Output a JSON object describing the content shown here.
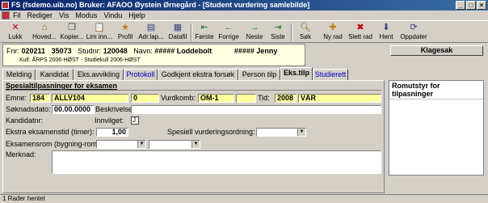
{
  "window": {
    "title": "FS (fsdemo.uib.no) Bruker: AFAOO Øystein Ørnegård - [Student vurdering samlebilde]"
  },
  "menu": [
    "Fil",
    "Rediger",
    "Vis",
    "Modus",
    "Vindu",
    "Hjelp"
  ],
  "toolbar": [
    {
      "label": "Lukk",
      "icon": "close-icon"
    },
    {
      "label": "Hoved...",
      "icon": "home-icon"
    },
    {
      "label": "Kopier...",
      "icon": "copy-icon"
    },
    {
      "label": "Lim inn...",
      "icon": "paste-icon"
    },
    {
      "label": "Profil",
      "icon": "profile-icon"
    },
    {
      "label": "Adr.lap...",
      "icon": "address-label-icon"
    },
    {
      "label": "Datafil",
      "icon": "datafile-icon"
    },
    {
      "label": "Første",
      "icon": "first-icon"
    },
    {
      "label": "Forrige",
      "icon": "previous-icon"
    },
    {
      "label": "Neste",
      "icon": "next-icon"
    },
    {
      "label": "Siste",
      "icon": "last-icon"
    },
    {
      "label": "Søk",
      "icon": "search-icon"
    },
    {
      "label": "Ny rad",
      "icon": "new-row-icon"
    },
    {
      "label": "Slett rad",
      "icon": "delete-row-icon"
    },
    {
      "label": "Hent",
      "icon": "fetch-icon"
    },
    {
      "label": "Oppdater",
      "icon": "update-icon"
    }
  ],
  "student": {
    "fnr_label": "Fnr:",
    "fnr": "020211",
    "fnr2": "35073",
    "studnr_label": "Studnr:",
    "studnr": "120048",
    "navn_label": "Navn:",
    "etternavn": "##### Loddebolt",
    "fornavn": "##### Jenny",
    "kull": "Kull: ÅRPS 2006-HØST - Studiekull 2006-HØST"
  },
  "klagesak_button": "Klagesak",
  "tabs": [
    "Melding",
    "Kandidat",
    "Eks.avvikling",
    "Protokoll",
    "Godkjent ekstra forsøk",
    "Person tilp",
    "Eks.tilp",
    "Studierett"
  ],
  "form": {
    "section_title": "Spesialtilpasninger for eksamen",
    "emne_label": "Emne:",
    "emne_inst": "184",
    "emne_kode": "ALLV104",
    "emne_versjon": "0",
    "vurdkomb_label": "Vurdkomb:",
    "vurdkomb": "OM-1",
    "tid_label": "Tid:",
    "tid_aar": "2008",
    "tid_termin": "VÅR",
    "soknadsdato_label": "Søknadsdato:",
    "soknadsdato": "00.00.0000",
    "beskrivelse_label": "Beskrivelse:",
    "beskrivelse": "",
    "kandidatnr_label": "Kandidatnr:",
    "kandidatnr": "",
    "innvilget_label": "Innvilget:",
    "innvilget": "J",
    "ekstratid_label": "Ekstra eksamenstid (timer):",
    "ekstratid": "1,00",
    "spesiell_label": "Spesiell vurderingsordning:",
    "spesiell": "",
    "eksamensrom_label": "Eksamensrom (bygning-rom):",
    "bygning": "",
    "rom": "",
    "merknad_label": "Merknad:",
    "merknad": ""
  },
  "right_panel": {
    "title": "Romutstyr for tilpasninger"
  },
  "status": "1 Rader hentet"
}
